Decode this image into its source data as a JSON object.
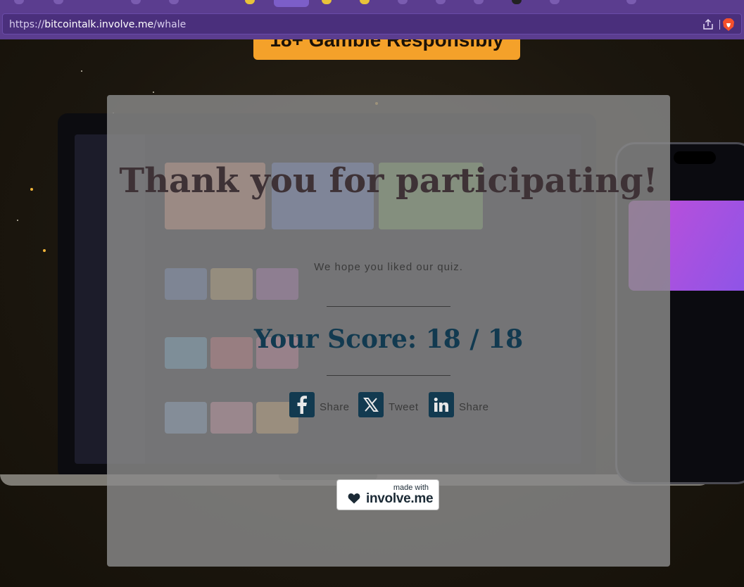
{
  "browser": {
    "url_scheme": "https://",
    "url_host": "bitcointalk.involve.me",
    "url_path": "/whale",
    "icons": [
      "share-icon",
      "brave-lion-icon"
    ]
  },
  "background": {
    "banner_text": "18+ Gamble Responsibly"
  },
  "modal": {
    "title": "Thank you for participating!",
    "subtitle": "We hope you liked our quiz.",
    "score_label": "Your Score:",
    "score_value": "18 / 18",
    "share_buttons": [
      {
        "label": "Share",
        "icon": "facebook-icon"
      },
      {
        "label": "Tweet",
        "icon": "x-twitter-icon"
      },
      {
        "label": "Share",
        "icon": "linkedin-icon"
      }
    ],
    "badge": {
      "small_text": "made with",
      "brand": "involve.me",
      "icon": "heart-icon"
    }
  },
  "colors": {
    "browser_chrome": "#5b3d8f",
    "modal_overlay": "#8a8a8a",
    "title": "#3e3236",
    "score": "#123a50",
    "banner": "#f4a12a"
  }
}
